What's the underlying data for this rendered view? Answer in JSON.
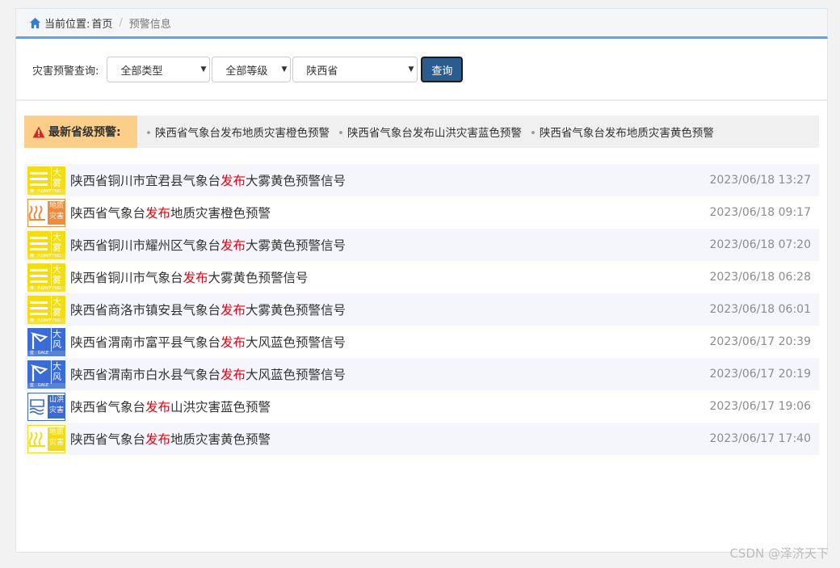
{
  "breadcrumb": {
    "label": "当前位置:",
    "home": "首页",
    "separator": "/",
    "current": "预警信息"
  },
  "filter": {
    "label": "灾害预警查询:",
    "type_select": "全部类型",
    "level_select": "全部等级",
    "province_select": "陕西省",
    "query_button": "查询"
  },
  "latest": {
    "heading": "最新省级预警:",
    "items": [
      "陕西省气象台发布地质灾害橙色预警",
      "陕西省气象台发布山洪灾害蓝色预警",
      "陕西省气象台发布地质灾害黄色预警"
    ]
  },
  "warnings": [
    {
      "icon": "fog-yellow-icon",
      "pre": "陕西省铜川市宜君县气象台",
      "verb": "发布",
      "post": "大雾黄色预警信号",
      "time": "2023/06/18 13:27"
    },
    {
      "icon": "geo-orange-icon",
      "pre": "陕西省气象台",
      "verb": "发布",
      "post": "地质灾害橙色预警",
      "time": "2023/06/18 09:17"
    },
    {
      "icon": "fog-yellow-icon",
      "pre": "陕西省铜川市耀州区气象台",
      "verb": "发布",
      "post": "大雾黄色预警信号",
      "time": "2023/06/18 07:20"
    },
    {
      "icon": "fog-yellow-icon",
      "pre": "陕西省铜川市气象台",
      "verb": "发布",
      "post": "大雾黄色预警信号",
      "time": "2023/06/18 06:28"
    },
    {
      "icon": "fog-yellow-icon",
      "pre": "陕西省商洛市镇安县气象台",
      "verb": "发布",
      "post": "大雾黄色预警信号",
      "time": "2023/06/18 06:01"
    },
    {
      "icon": "wind-blue-icon",
      "pre": "陕西省渭南市富平县气象台",
      "verb": "发布",
      "post": "大风蓝色预警信号",
      "time": "2023/06/17 20:39"
    },
    {
      "icon": "wind-blue-icon",
      "pre": "陕西省渭南市白水县气象台",
      "verb": "发布",
      "post": "大风蓝色预警信号",
      "time": "2023/06/17 20:19"
    },
    {
      "icon": "flood-blue-icon",
      "pre": "陕西省气象台",
      "verb": "发布",
      "post": "山洪灾害蓝色预警",
      "time": "2023/06/17 19:06"
    },
    {
      "icon": "geo-yellow-icon",
      "pre": "陕西省气象台",
      "verb": "发布",
      "post": "地质灾害黄色预警",
      "time": "2023/06/17 17:40"
    }
  ],
  "icon_text": {
    "fog": [
      "大",
      "雾"
    ],
    "fog_sub": "黄",
    "fog_en": "HEAVY FOG",
    "wind": [
      "大",
      "风"
    ],
    "wind_sub": "蓝",
    "wind_en": "GALE",
    "geo": [
      "地质",
      "灾害"
    ],
    "flood": [
      "山洪",
      "灾害"
    ]
  },
  "colors": {
    "accent": "#5aa6e8",
    "button": "#2c5c8f",
    "highlight": "#e60012",
    "yellow": "#f2dc16",
    "orange": "#f08a3c",
    "blue": "#3b6bd6"
  },
  "watermark": "CSDN @泽济天下"
}
